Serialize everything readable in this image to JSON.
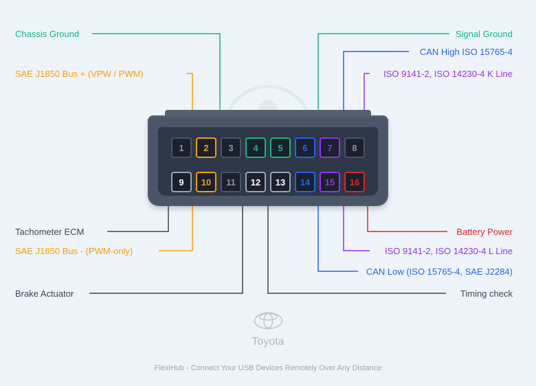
{
  "pins": [
    {
      "num": "1",
      "active": false
    },
    {
      "num": "2",
      "active": true,
      "color": "#f59e0b"
    },
    {
      "num": "3",
      "active": false
    },
    {
      "num": "4",
      "active": true,
      "color": "#10b981"
    },
    {
      "num": "5",
      "active": true,
      "color": "#10b981"
    },
    {
      "num": "6",
      "active": true,
      "color": "#2563eb"
    },
    {
      "num": "7",
      "active": true,
      "color": "#9333ea"
    },
    {
      "num": "8",
      "active": false
    },
    {
      "num": "9",
      "active": true,
      "color": "#9aa5b5"
    },
    {
      "num": "10",
      "active": true,
      "color": "#f59e0b"
    },
    {
      "num": "11",
      "active": false
    },
    {
      "num": "12",
      "active": true,
      "color": "#9aa5b5"
    },
    {
      "num": "13",
      "active": true,
      "color": "#9aa5b5"
    },
    {
      "num": "14",
      "active": true,
      "color": "#2563eb"
    },
    {
      "num": "15",
      "active": true,
      "color": "#9333ea"
    },
    {
      "num": "16",
      "active": true,
      "color": "#dc2626"
    }
  ],
  "labels": {
    "pin4": "Chassis Ground",
    "pin5": "Signal Ground",
    "pin6": "CAN High ISO 15765-4",
    "pin2": "SAE J1850 Bus + (VPW / PWM)",
    "pin7": "ISO 9141-2, ISO 14230-4 K Line",
    "pin9": "Tachometer ECM",
    "pin16": "Battery Power",
    "pin10": "SAE J1850 Bus - (PWM-only)",
    "pin15": "ISO 9141-2, ISO 14230-4 L Line",
    "pin14": "CAN Low (ISO 15765-4, SAE J2284)",
    "pin12": "Brake Actuator",
    "pin13": "Timing check"
  },
  "colors": {
    "green": "#10b981",
    "orange": "#f59e0b",
    "blue": "#2563eb",
    "purple": "#9333ea",
    "red": "#dc2626",
    "gray": "#3a4556"
  },
  "brand": "Toyota",
  "tagline": "FlexiHub - Connect Your USB Devices Remotely Over Any Distance"
}
